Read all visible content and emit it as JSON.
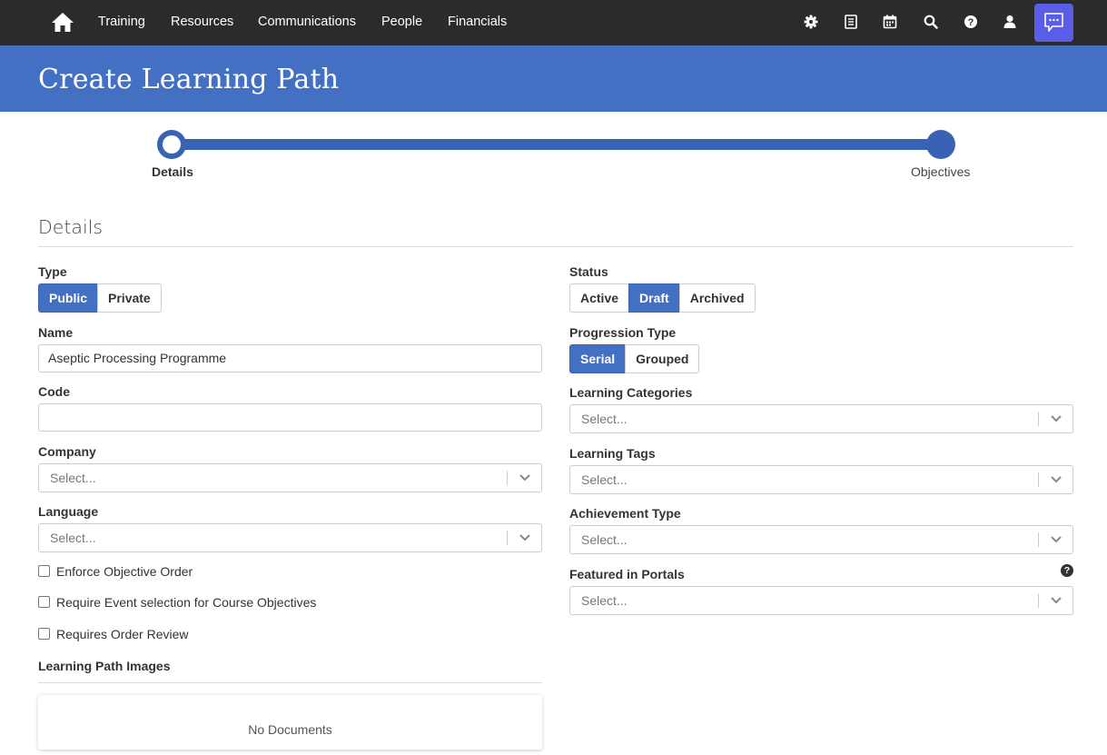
{
  "nav": {
    "items": [
      "Training",
      "Resources",
      "Communications",
      "People",
      "Financials"
    ],
    "icons": [
      "home-icon",
      "gear-icon",
      "list-icon",
      "calendar-icon",
      "search-icon",
      "help-icon",
      "user-icon",
      "chat-icon"
    ],
    "colors": {
      "bar": "#2b2b2b",
      "chat_button": "#5a5de8"
    }
  },
  "header": {
    "title": "Create Learning Path",
    "color": "#4470c4"
  },
  "stepper": {
    "steps": [
      {
        "label": "Details",
        "current": true
      },
      {
        "label": "Objectives",
        "current": false
      }
    ]
  },
  "section": {
    "title": "Details"
  },
  "form": {
    "type": {
      "label": "Type",
      "options": [
        "Public",
        "Private"
      ],
      "selected": "Public"
    },
    "name": {
      "label": "Name",
      "value": "Aseptic Processing Programme"
    },
    "code": {
      "label": "Code",
      "value": ""
    },
    "company": {
      "label": "Company",
      "placeholder": "Select..."
    },
    "language": {
      "label": "Language",
      "placeholder": "Select..."
    },
    "checkboxes": [
      {
        "label": "Enforce Objective Order",
        "checked": false
      },
      {
        "label": "Require Event selection for Course Objectives",
        "checked": false
      },
      {
        "label": "Requires Order Review",
        "checked": false
      }
    ],
    "images": {
      "label": "Learning Path Images",
      "empty_text": "No Documents"
    },
    "status": {
      "label": "Status",
      "options": [
        "Active",
        "Draft",
        "Archived"
      ],
      "selected": "Draft"
    },
    "progression": {
      "label": "Progression Type",
      "options": [
        "Serial",
        "Grouped"
      ],
      "selected": "Serial"
    },
    "categories": {
      "label": "Learning Categories",
      "placeholder": "Select..."
    },
    "tags": {
      "label": "Learning Tags",
      "placeholder": "Select..."
    },
    "achievement": {
      "label": "Achievement Type",
      "placeholder": "Select..."
    },
    "portals": {
      "label": "Featured in Portals",
      "placeholder": "Select...",
      "help": "?"
    }
  },
  "accent": "#3a62b4"
}
